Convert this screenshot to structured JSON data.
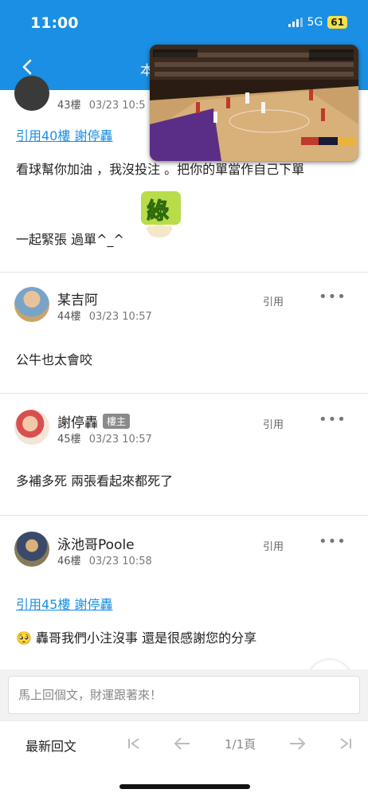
{
  "status": {
    "time": "11:00",
    "network": "5G",
    "battery": "61"
  },
  "header": {
    "title": "本"
  },
  "posts": [
    {
      "floor": "43樓",
      "time": "03/23 10:5",
      "quote": "引用40樓 謝停轟",
      "content": [
        "看球幫你加油 ，我沒投注 。把你的單當作自己下單",
        "一起緊張 過單^_^"
      ],
      "sticker_text": "綠"
    },
    {
      "author": "某吉阿",
      "floor": "44樓",
      "time": "03/23 10:57",
      "quote_label": "引用",
      "content": [
        "公牛也太會咬"
      ]
    },
    {
      "author": "謝停轟",
      "badge": "樓主",
      "floor": "45樓",
      "time": "03/23 10:57",
      "quote_label": "引用",
      "content": [
        "多補多死 兩張看起來都死了"
      ]
    },
    {
      "author": "泳池哥Poole",
      "floor": "46樓",
      "time": "03/23 10:58",
      "quote_label": "引用",
      "quote": "引用45樓 謝停轟",
      "content": [
        "🥺 轟哥我們小注沒事 還是很感謝您的分享"
      ]
    }
  ],
  "reply": {
    "placeholder": "馬上回個文，財運跟著來！"
  },
  "bottom": {
    "latest": "最新回文",
    "page": "1/1頁"
  },
  "icons": {
    "back": "chevron-left-icon",
    "more": "more-dots-icon",
    "scroll_top": "arrow-up-icon",
    "first_page": "first-page-icon",
    "prev_page": "arrow-left-icon",
    "next_page": "arrow-right-icon",
    "last_page": "last-page-icon"
  },
  "colors": {
    "accent": "#1a8fe3",
    "badge": "#8a8a8a"
  }
}
